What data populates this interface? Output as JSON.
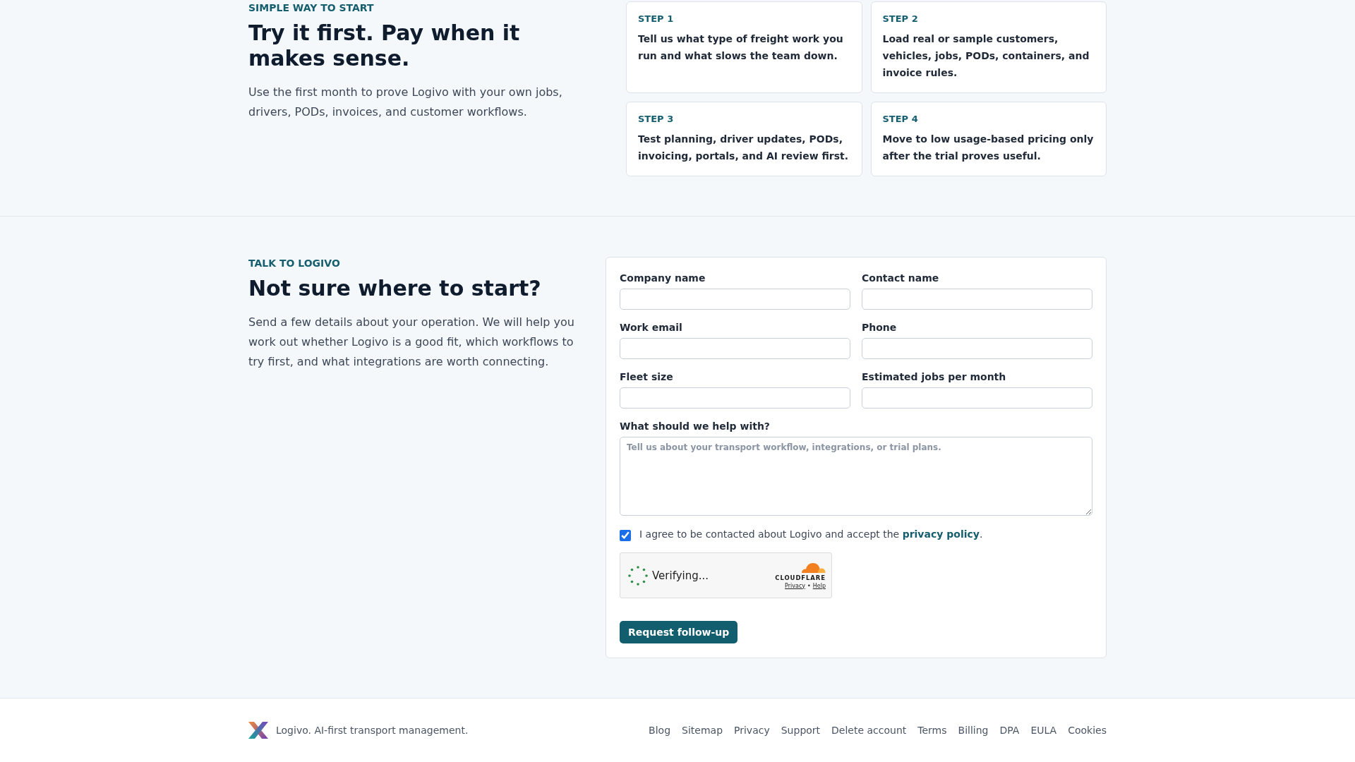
{
  "trial": {
    "eyebrow": "SIMPLE WAY TO START",
    "title": "Try it first. Pay when it makes sense.",
    "text": "Use the first month to prove Logivo with your own jobs, drivers, PODs, invoices, and customer workflows.",
    "steps": [
      {
        "label": "STEP 1",
        "text": "Tell us what type of freight work you run and what slows the team down."
      },
      {
        "label": "STEP 2",
        "text": "Load real or sample customers, vehicles, jobs, PODs, containers, and invoice rules."
      },
      {
        "label": "STEP 3",
        "text": "Test planning, driver updates, PODs, invoicing, portals, and AI review first."
      },
      {
        "label": "STEP 4",
        "text": "Move to low usage-based pricing only after the trial proves useful."
      }
    ]
  },
  "contact": {
    "eyebrow": "TALK TO LOGIVO",
    "title": "Not sure where to start?",
    "text": "Send a few details about your operation. We will help you work out whether Logivo is a good fit, which workflows to try first, and what integrations are worth connecting.",
    "form": {
      "fields": [
        {
          "kind": "text",
          "label": "Company name"
        },
        {
          "kind": "text",
          "label": "Contact name"
        },
        {
          "kind": "text",
          "label": "Work email"
        },
        {
          "kind": "text",
          "label": "Phone"
        },
        {
          "kind": "text",
          "label": "Fleet size"
        },
        {
          "kind": "text",
          "label": "Estimated jobs per month"
        },
        {
          "kind": "textarea",
          "label": "What should we help with?",
          "placeholder": "Tell us about your transport workflow, integrations, or trial plans."
        }
      ],
      "consent": {
        "checked": true,
        "text": "I agree to be contacted about Logivo and accept the",
        "link": "privacy policy",
        "end": "."
      },
      "captcha": {
        "status": "Verifying...",
        "brand": "CLOUDFLARE",
        "links": [
          "Privacy",
          "Help"
        ],
        "separator": "•"
      },
      "submit": "Request follow-up"
    }
  },
  "footer": {
    "tagline": "Logivo. AI-first transport management.",
    "links": [
      "Blog",
      "Sitemap",
      "Privacy",
      "Support",
      "Delete account",
      "Terms",
      "Billing",
      "DPA",
      "EULA",
      "Cookies"
    ]
  }
}
